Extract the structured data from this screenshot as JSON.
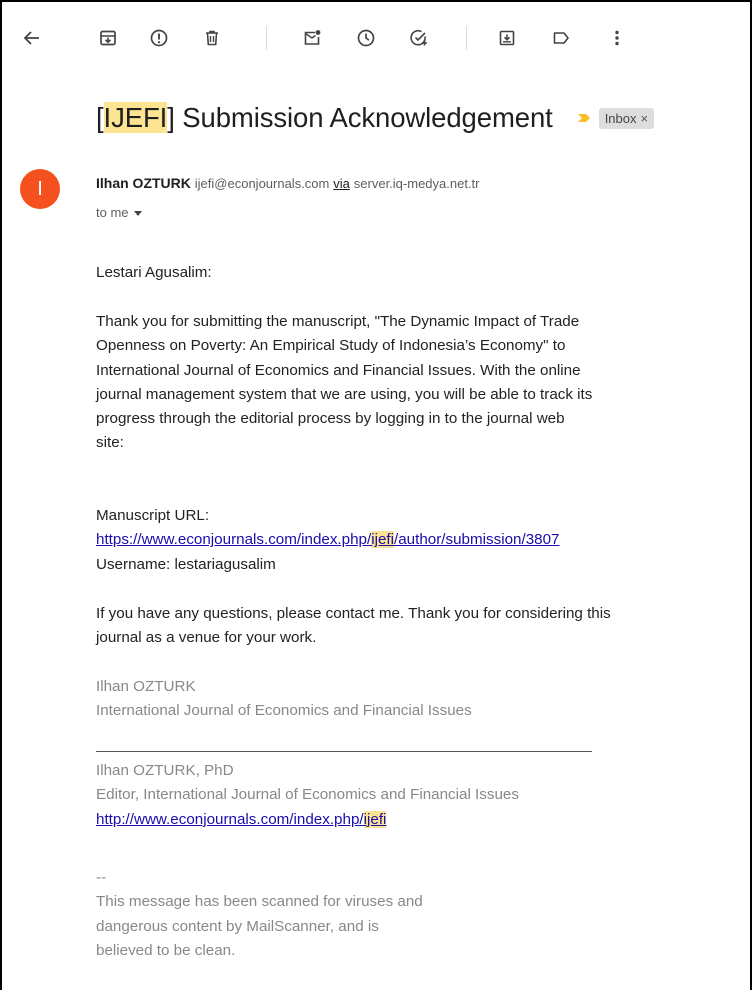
{
  "toolbar": {
    "buttons": [
      {
        "name": "back-button",
        "icon": "arrow-left-icon"
      },
      {
        "name": "archive-button",
        "icon": "archive-icon"
      },
      {
        "name": "report-spam-button",
        "icon": "report-icon"
      },
      {
        "name": "delete-button",
        "icon": "trash-icon"
      },
      {
        "name": "mark-unread-button",
        "icon": "mark-unread-icon"
      },
      {
        "name": "snooze-button",
        "icon": "clock-icon"
      },
      {
        "name": "add-to-tasks-button",
        "icon": "add-task-icon"
      },
      {
        "name": "move-to-button",
        "icon": "move-to-icon"
      },
      {
        "name": "labels-button",
        "icon": "label-icon"
      },
      {
        "name": "more-button",
        "icon": "more-vert-icon"
      }
    ]
  },
  "email": {
    "subject_open": "[",
    "subject_highlight": "IJEFI",
    "subject_rest": "] Submission Acknowledgement",
    "label": "Inbox",
    "label_close": "×",
    "sender": {
      "initial": "I",
      "name": "Ilhan OZTURK",
      "email": "ijefi@econjournals.com",
      "via": "via",
      "via_host": "server.iq-medya.net.tr"
    },
    "to": "to me",
    "greeting": "Lestari Agusalim:",
    "paragraph1": [
      "Thank you for submitting the manuscript, \"The Dynamic Impact of Trade",
      "Openness on Poverty: An Empirical Study of Indonesia’s Economy\" to",
      "International Journal of Economics and Financial Issues. With the online",
      "journal management system that we are using, you will be able to track its",
      "progress through the editorial process by logging in to the journal web",
      "site:"
    ],
    "manuscript_url_label": "Manuscript URL:",
    "manuscript_url_pre": "https://www.econjournals.com/index.php/",
    "manuscript_url_hl": "ijefi",
    "manuscript_url_post": "/author/submission/3807",
    "username": "Username: lestariagusalim",
    "paragraph2": [
      "If you have any questions, please contact me. Thank you for considering this",
      "journal as a venue for your work."
    ],
    "signature": {
      "name": "Ilhan OZTURK",
      "org": "International Journal of Economics and Financial Issues",
      "name_phd": "Ilhan OZTURK, PhD",
      "title": "Editor, International Journal of Economics and Financial Issues",
      "url_pre": "http://www.econjournals.com/index.php/",
      "url_hl": "ijefi"
    },
    "footer": {
      "dashes": "--",
      "lines": [
        "This message has been scanned for viruses and",
        "dangerous content by MailScanner, and is",
        "believed to be clean."
      ]
    }
  },
  "colors": {
    "avatar": "#f4511e",
    "highlight": "#fce492",
    "link": "#1a0dab",
    "importance_marker": "#f6bf26"
  }
}
